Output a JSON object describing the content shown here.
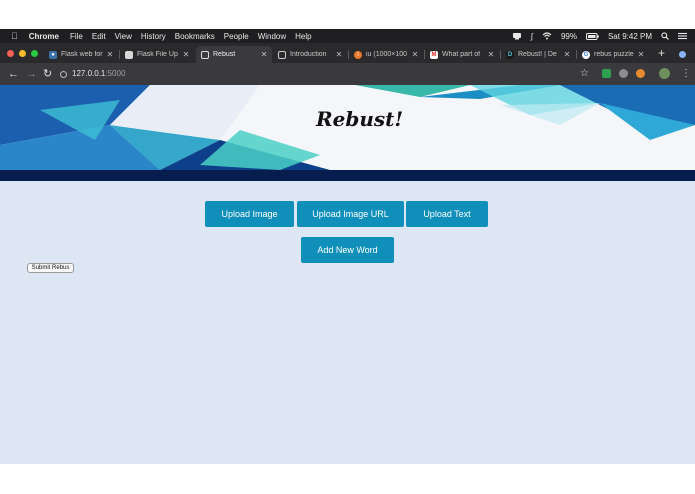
{
  "menubar": {
    "apple": "",
    "items": [
      "Chrome",
      "File",
      "Edit",
      "View",
      "History",
      "Bookmarks",
      "People",
      "Window",
      "Help"
    ],
    "battery": "99%",
    "clock": "Sat 9:42 PM"
  },
  "tabs": [
    {
      "title": "Flask web for",
      "favicon": "python-icon",
      "active": false
    },
    {
      "title": "Flask File Up",
      "favicon": "page-icon",
      "active": false
    },
    {
      "title": "Rebust",
      "favicon": "document-icon",
      "active": true
    },
    {
      "title": "Introduction",
      "favicon": "document-icon",
      "active": false
    },
    {
      "title": "iu (1000×100",
      "favicon": "orange-icon",
      "active": false
    },
    {
      "title": "What part of",
      "favicon": "gmail-icon",
      "active": false
    },
    {
      "title": "Rebust! | De",
      "favicon": "devpost-icon",
      "active": false
    },
    {
      "title": "rebus puzzle",
      "favicon": "google-icon",
      "active": false
    }
  ],
  "address": {
    "host": "127.0.0.1",
    "port": ":5000"
  },
  "page": {
    "title": "Rebust!",
    "buttons": {
      "upload_image": "Upload Image",
      "upload_image_url": "Upload Image URL",
      "upload_text": "Upload Text",
      "add_new_word": "Add New Word"
    },
    "submit_label": "Submit Rebus"
  },
  "colors": {
    "page_bg": "#dde7f3",
    "button": "#0f8fba",
    "navy_bar": "#071d4e",
    "menubar": "#1f1f22",
    "tabbar": "#2a2a2d",
    "toolbar": "#3a3a3e"
  }
}
